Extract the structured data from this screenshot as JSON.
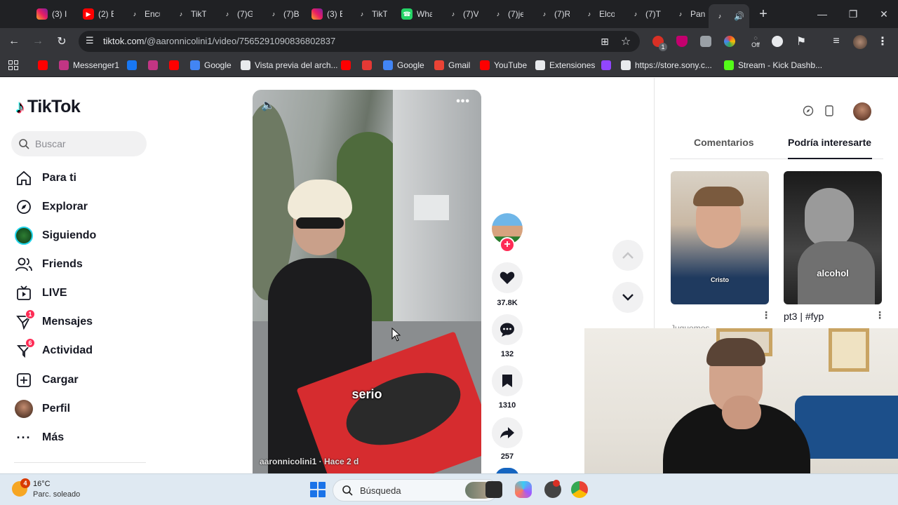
{
  "browser": {
    "tabs": [
      {
        "title": "(3) I",
        "icon": "instagram-icon"
      },
      {
        "title": "(2) E",
        "icon": "youtube-icon"
      },
      {
        "title": "Encu",
        "icon": "tiktok-icon"
      },
      {
        "title": "TikT",
        "icon": "tiktok-icon"
      },
      {
        "title": "(7)G",
        "icon": "tiktok-icon"
      },
      {
        "title": "(7)B",
        "icon": "tiktok-icon"
      },
      {
        "title": "(3) E",
        "icon": "instagram-icon"
      },
      {
        "title": "TikT",
        "icon": "tiktok-icon"
      },
      {
        "title": "Wha",
        "icon": "whatsapp-icon"
      },
      {
        "title": "(7)V",
        "icon": "tiktok-icon"
      },
      {
        "title": "(7)je",
        "icon": "tiktok-icon"
      },
      {
        "title": "(7)R",
        "icon": "tiktok-icon"
      },
      {
        "title": "Elco",
        "icon": "tiktok-icon"
      },
      {
        "title": "(7)T",
        "icon": "tiktok-icon"
      },
      {
        "title": "Pan",
        "icon": "tiktok-icon"
      },
      {
        "title": "C",
        "icon": "tiktok-icon",
        "active": true
      }
    ],
    "new_tab_label": "+",
    "url_domain": "tiktok.com",
    "url_path": "/@aaronnicolini1/video/7565291090836802837",
    "bookmarks": [
      {
        "label": "",
        "color": "#ff0000"
      },
      {
        "label": "Messenger1",
        "color": "#c13584"
      },
      {
        "label": "",
        "color": "#1877f2"
      },
      {
        "label": "",
        "color": "#c13584"
      },
      {
        "label": "",
        "color": "#ff0000"
      },
      {
        "label": "Google",
        "color": "#4285f4"
      },
      {
        "label": "Vista previa del arch...",
        "color": "#e8eaed"
      },
      {
        "label": "",
        "color": "#ff0000"
      },
      {
        "label": "",
        "color": "#e53935"
      },
      {
        "label": "Google",
        "color": "#4285f4"
      },
      {
        "label": "Gmail",
        "color": "#ea4335"
      },
      {
        "label": "YouTube",
        "color": "#ff0000"
      },
      {
        "label": "Extensiones",
        "color": "#e8eaed"
      },
      {
        "label": "",
        "color": "#9146ff"
      },
      {
        "label": "https://store.sony.c...",
        "color": "#e8eaed"
      },
      {
        "label": "Stream - Kick Dashb...",
        "color": "#53fc18"
      }
    ],
    "extension_badge": "1",
    "extension_off": "Off"
  },
  "tiktok": {
    "brand": "TikTok",
    "search_placeholder": "Buscar",
    "nav": [
      {
        "label": "Para ti",
        "icon": "home-icon"
      },
      {
        "label": "Explorar",
        "icon": "compass-icon"
      },
      {
        "label": "Siguiendo",
        "icon": "following-avatar-icon"
      },
      {
        "label": "Friends",
        "icon": "friends-icon"
      },
      {
        "label": "LIVE",
        "icon": "live-icon"
      },
      {
        "label": "Mensajes",
        "icon": "messages-icon",
        "badge": "1"
      },
      {
        "label": "Actividad",
        "icon": "activity-icon",
        "badge": "6"
      },
      {
        "label": "Cargar",
        "icon": "upload-icon"
      },
      {
        "label": "Perfil",
        "icon": "profile-avatar-icon"
      },
      {
        "label": "Más",
        "icon": "more-icon"
      }
    ],
    "video": {
      "caption": "serio",
      "author_line": "aaronnicolini1 · Hace 2 d"
    },
    "actions": {
      "likes": "37.8K",
      "comments": "132",
      "saves": "1310",
      "shares": "257"
    },
    "right_panel": {
      "tabs": [
        "Comentarios",
        "Podría interesarte"
      ],
      "active_tab": "Podría interesarte",
      "thumbnails": [
        {
          "overlay_text": "Cristo",
          "title": "Juguemos",
          "top_text": ""
        },
        {
          "overlay_text": "alcohol",
          "title": "pt3 | #fyp"
        }
      ]
    }
  },
  "taskbar": {
    "temperature": "16°C",
    "weather": "Parc. soleado",
    "weather_badge": "4",
    "search_label": "Búsqueda"
  }
}
